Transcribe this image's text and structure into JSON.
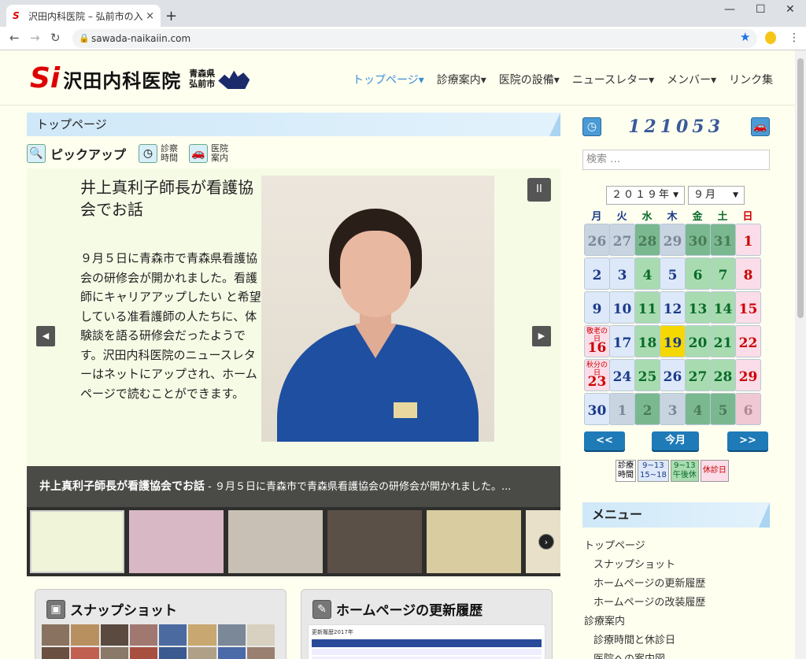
{
  "browser": {
    "tab_title": "沢田内科医院 – 弘前市の入院診療",
    "tab_close": "×",
    "new_tab": "+",
    "win_min": "—",
    "win_max": "☐",
    "win_close": "✕",
    "back": "←",
    "forward": "→",
    "reload": "↻",
    "url": "sawada-naikaiin.com",
    "star": "★",
    "kebab": "⋮"
  },
  "site": {
    "logo_mark": "Si",
    "logo_name": "沢田内科医院",
    "logo_loc1": "青森県",
    "logo_loc2": "弘前市"
  },
  "nav": [
    "トップページ▾",
    "診療案内▾",
    "医院の設備▾",
    "ニュースレター▾",
    "メンバー▾",
    "リンク集"
  ],
  "breadcrumb": "トップページ",
  "pickup": {
    "label": "ピックアップ",
    "hours_line1": "診察",
    "hours_line2": "時間",
    "guide_line1": "医院",
    "guide_line2": "案内"
  },
  "slide": {
    "title": "井上真利子師長が看護協会でお話",
    "body": "９月５日に青森市で青森県看護協会の研修会が開かれました。看護師にキャリアアップしたい と希望している准看護師の人たちに、体験談を語る研修会だったようです。沢田内科医院のニュースレターはネットにアップされ、ホームページで読むことができます。",
    "pause": "II",
    "prev": "◀",
    "next": "▶",
    "caption_bold": "井上真利子師長が看護協会でお話",
    "caption_rest": " - ９月５日に青森市で青森県看護協会の研修会が開かれました。..."
  },
  "thumbs_next": "›",
  "cards": {
    "snapshot": "スナップショット",
    "history": "ホームページの更新履歴",
    "history_doc_title": "更新履歴2017年"
  },
  "sidebar": {
    "counter": "121053",
    "search_placeholder": "検索 …",
    "year": "２０１９年",
    "month": "９月",
    "dow": [
      "月",
      "火",
      "水",
      "木",
      "金",
      "土",
      "日"
    ],
    "prev_btn": "<<",
    "today_btn": "今月",
    "next_btn": ">>",
    "legend": {
      "l1a": "診療",
      "l1b": "時間",
      "l2a": "9~13",
      "l2b": "15~18",
      "l3a": "9~13",
      "l3b": "午後休",
      "l4": "休診日"
    },
    "menu_title": "メニュー",
    "menu_items": [
      "トップページ",
      "スナップショット",
      "ホームページの更新履歴",
      "ホームページの改装履歴",
      "診療案内",
      "診療時間と休診日",
      "医院への案内図"
    ]
  },
  "calendar": {
    "weeks": [
      [
        {
          "d": "26",
          "t": "out"
        },
        {
          "d": "27",
          "t": "out"
        },
        {
          "d": "28",
          "t": "outg"
        },
        {
          "d": "29",
          "t": "out"
        },
        {
          "d": "30",
          "t": "outg"
        },
        {
          "d": "31",
          "t": "outg"
        },
        {
          "d": "1",
          "t": "hol"
        }
      ],
      [
        {
          "d": "2",
          "t": "wk"
        },
        {
          "d": "3",
          "t": "wk"
        },
        {
          "d": "4",
          "t": "half"
        },
        {
          "d": "5",
          "t": "wk"
        },
        {
          "d": "6",
          "t": "half"
        },
        {
          "d": "7",
          "t": "half"
        },
        {
          "d": "8",
          "t": "hol"
        }
      ],
      [
        {
          "d": "9",
          "t": "wk"
        },
        {
          "d": "10",
          "t": "wk"
        },
        {
          "d": "11",
          "t": "half"
        },
        {
          "d": "12",
          "t": "wk"
        },
        {
          "d": "13",
          "t": "half"
        },
        {
          "d": "14",
          "t": "half"
        },
        {
          "d": "15",
          "t": "hol"
        }
      ],
      [
        {
          "d": "16",
          "t": "hol",
          "n": "敬老の日"
        },
        {
          "d": "17",
          "t": "wk"
        },
        {
          "d": "18",
          "t": "half"
        },
        {
          "d": "19",
          "t": "today"
        },
        {
          "d": "20",
          "t": "half"
        },
        {
          "d": "21",
          "t": "half"
        },
        {
          "d": "22",
          "t": "hol"
        }
      ],
      [
        {
          "d": "23",
          "t": "hol",
          "n": "秋分の日"
        },
        {
          "d": "24",
          "t": "wk"
        },
        {
          "d": "25",
          "t": "half"
        },
        {
          "d": "26",
          "t": "wk"
        },
        {
          "d": "27",
          "t": "half"
        },
        {
          "d": "28",
          "t": "half"
        },
        {
          "d": "29",
          "t": "hol"
        }
      ],
      [
        {
          "d": "30",
          "t": "wk"
        },
        {
          "d": "1",
          "t": "out"
        },
        {
          "d": "2",
          "t": "outg"
        },
        {
          "d": "3",
          "t": "out"
        },
        {
          "d": "4",
          "t": "outg"
        },
        {
          "d": "5",
          "t": "outg"
        },
        {
          "d": "6",
          "t": "outh"
        }
      ]
    ]
  }
}
